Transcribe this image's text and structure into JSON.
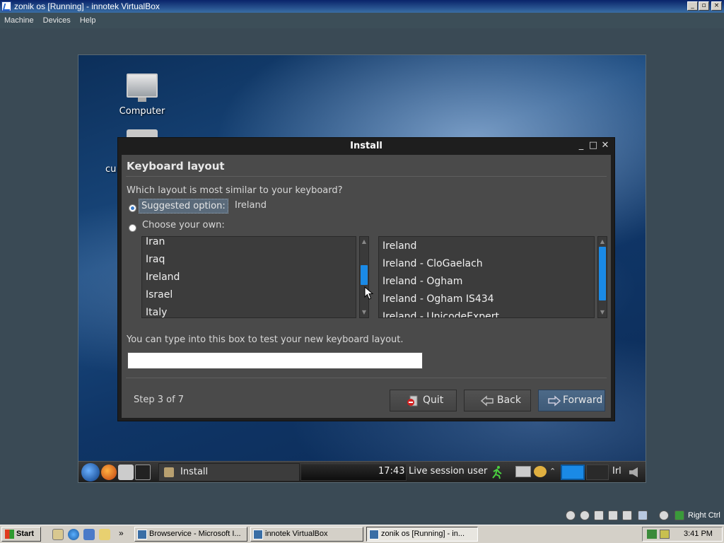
{
  "vbox": {
    "title": "zonik os [Running] - innotek VirtualBox",
    "menu": [
      "Machine",
      "Devices",
      "Help"
    ],
    "controls": {
      "minimize": "_",
      "maximize": "▫",
      "close": "×"
    }
  },
  "desktop": {
    "icons": [
      {
        "label": "Computer",
        "icon": "computer-icon"
      },
      {
        "label": "cu",
        "icon": "folder-icon"
      }
    ]
  },
  "dialog": {
    "title": "Install",
    "controls": {
      "minimize": "_",
      "maximize": "□",
      "close": "✕"
    },
    "heading": "Keyboard layout",
    "question": "Which layout is most similar to your keyboard?",
    "suggested_label": "Suggested option:",
    "suggested_value": "Ireland",
    "choose_label": "Choose your own:",
    "selected_option": "suggested",
    "countries": [
      "Iran",
      "Iraq",
      "Ireland",
      "Israel",
      "Italy"
    ],
    "variants": [
      "Ireland",
      "Ireland - CloGaelach",
      "Ireland - Ogham",
      "Ireland - Ogham IS434",
      "Ireland - UnicodeExpert"
    ],
    "test_label": "You can type into this box to test your new keyboard layout.",
    "test_value": "",
    "step": "Step 3 of 7",
    "buttons": {
      "quit": "Quit",
      "back": "Back",
      "forward": "Forward"
    },
    "scroll_arrows": {
      "up": "▲",
      "down": "▼"
    }
  },
  "guest_panel": {
    "task": "Install",
    "time": "17:43",
    "user": "Live session user",
    "keyboard": "Irl"
  },
  "host": {
    "tray_hint": "Right Ctrl",
    "start": "Start",
    "more": "»",
    "tasks": [
      "Browservice - Microsoft I...",
      "innotek VirtualBox",
      "zonik os [Running] - in..."
    ],
    "clock": "3:41 PM"
  },
  "colors": {
    "accent": "#1a8ae6",
    "dialog_bg": "#4a4a4a",
    "host_titlebar": "#0a246a"
  }
}
